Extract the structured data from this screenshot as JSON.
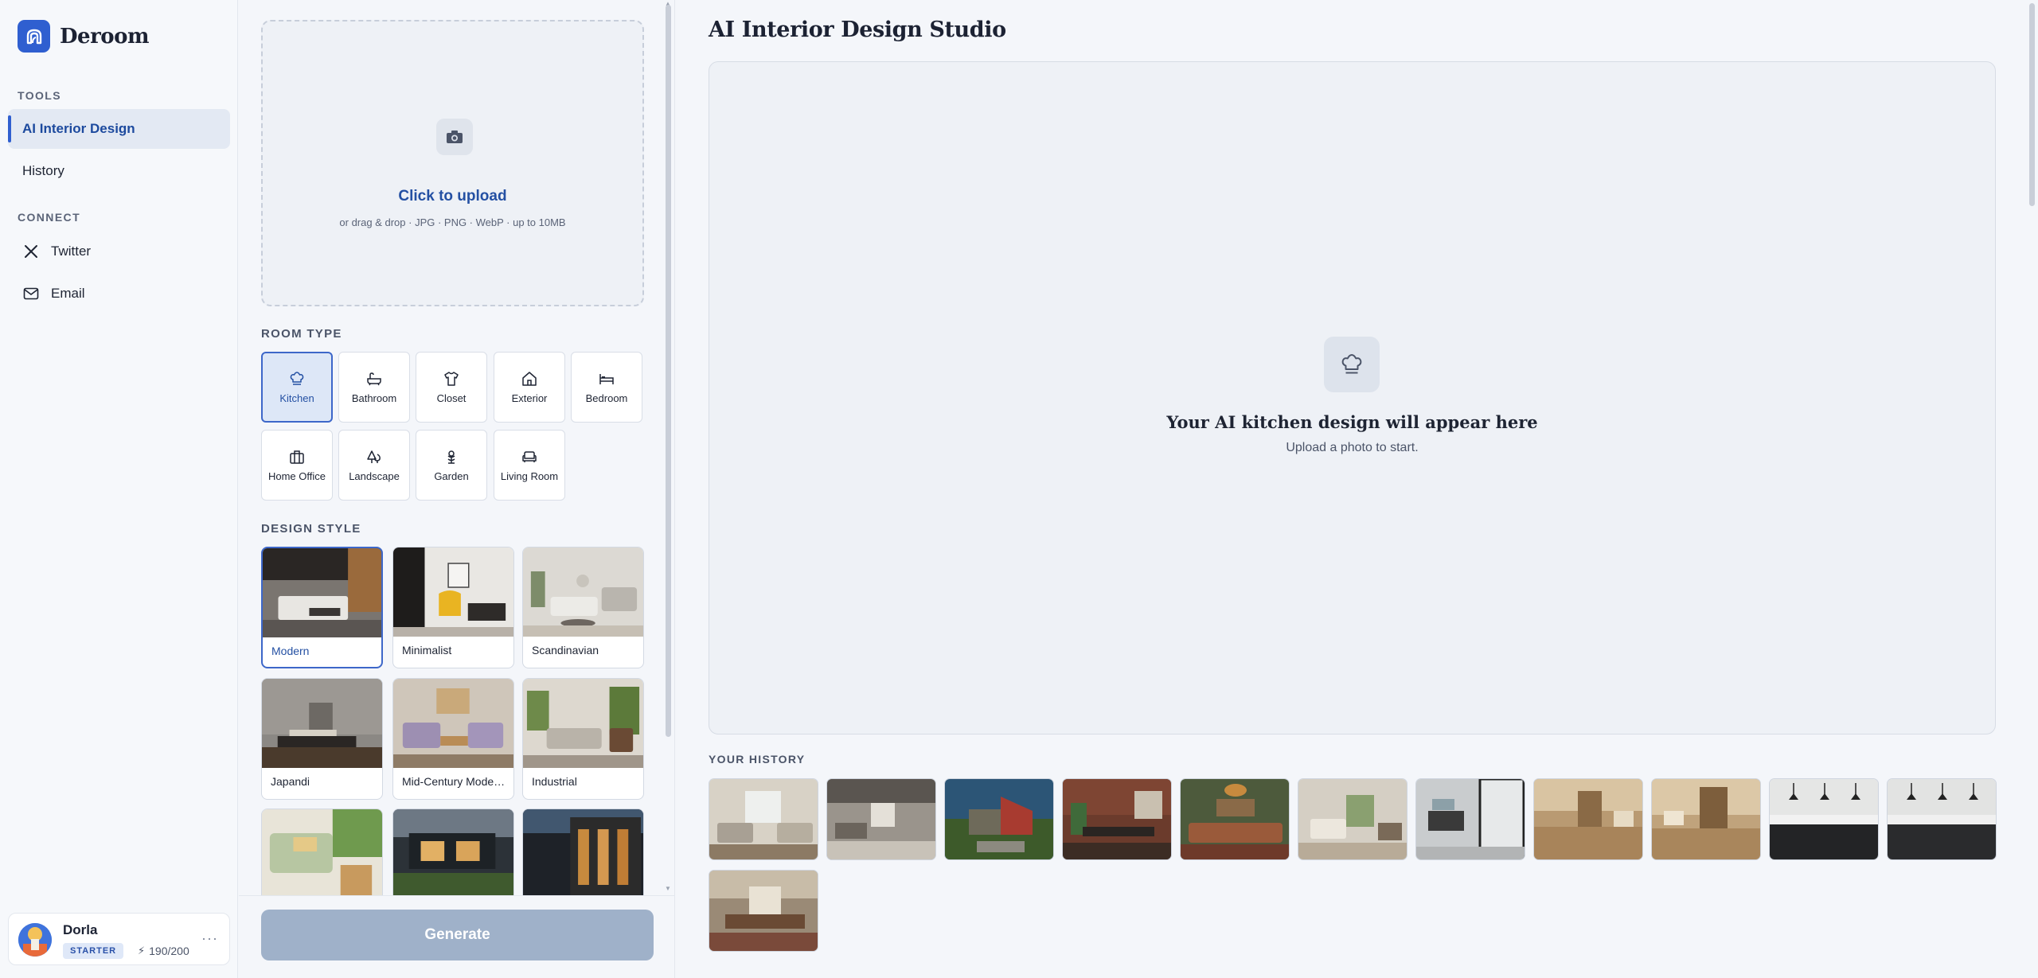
{
  "brand": {
    "name": "Deroom",
    "accent": "#2f5fd0"
  },
  "sidebar": {
    "tools_label": "TOOLS",
    "tools": [
      {
        "label": "AI Interior Design",
        "active": true
      },
      {
        "label": "History",
        "active": false
      }
    ],
    "connect_label": "CONNECT",
    "connect": [
      {
        "label": "Twitter",
        "icon": "x-logo-icon"
      },
      {
        "label": "Email",
        "icon": "mail-icon"
      }
    ],
    "user": {
      "name": "Dorla",
      "plan": "STARTER",
      "credits": "190/200",
      "more": "···"
    }
  },
  "upload": {
    "title": "Click to upload",
    "subtitle": "or drag & drop · JPG · PNG · WebP · up to 10MB",
    "icon": "camera-icon"
  },
  "room_type": {
    "label": "ROOM TYPE",
    "items": [
      {
        "label": "Kitchen",
        "icon": "chef-hat-icon",
        "selected": true
      },
      {
        "label": "Bathroom",
        "icon": "bathtub-icon",
        "selected": false
      },
      {
        "label": "Closet",
        "icon": "shirt-icon",
        "selected": false
      },
      {
        "label": "Exterior",
        "icon": "house-icon",
        "selected": false
      },
      {
        "label": "Bedroom",
        "icon": "bed-icon",
        "selected": false
      },
      {
        "label": "Home Office",
        "icon": "briefcase-icon",
        "selected": false
      },
      {
        "label": "Landscape",
        "icon": "trees-icon",
        "selected": false
      },
      {
        "label": "Garden",
        "icon": "flower-icon",
        "selected": false
      },
      {
        "label": "Living Room",
        "icon": "sofa-icon",
        "selected": false
      }
    ]
  },
  "design_style": {
    "label": "DESIGN STYLE",
    "items": [
      {
        "label": "Modern",
        "selected": true
      },
      {
        "label": "Minimalist",
        "selected": false
      },
      {
        "label": "Scandinavian",
        "selected": false
      },
      {
        "label": "Japandi",
        "selected": false
      },
      {
        "label": "Mid-Century Mode…",
        "selected": false
      },
      {
        "label": "Industrial",
        "selected": false
      },
      {
        "label": "",
        "selected": false
      },
      {
        "label": "",
        "selected": false
      },
      {
        "label": "",
        "selected": false
      }
    ]
  },
  "generate": {
    "label": "Generate"
  },
  "main": {
    "title": "AI Interior Design Studio",
    "empty_title": "Your AI kitchen design will appear here",
    "empty_subtitle": "Upload a photo to start.",
    "history_label": "YOUR HISTORY",
    "history_count": 12
  }
}
